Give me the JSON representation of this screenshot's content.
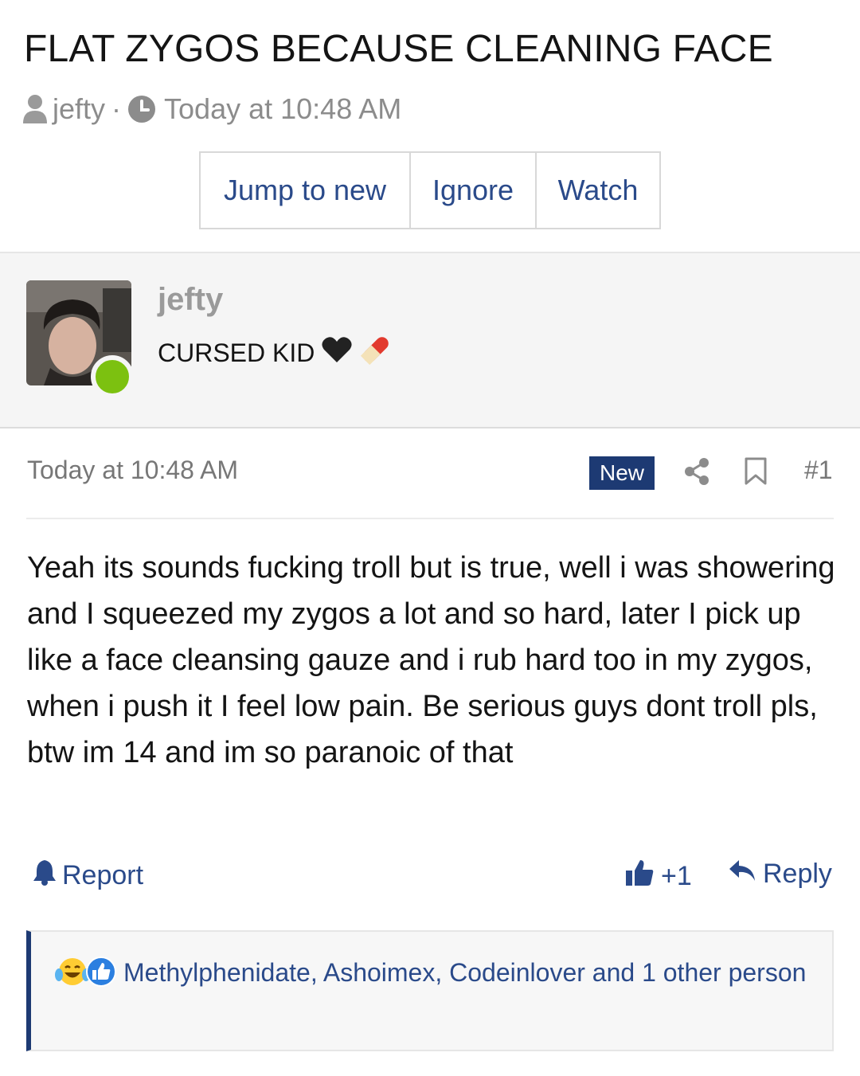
{
  "thread": {
    "title": "FLAT ZYGOS BECAUSE CLEANING FACE",
    "author": "jefty",
    "separator": "·",
    "time": "Today at 10:48 AM"
  },
  "actions": {
    "jump_label": "Jump to new",
    "ignore_label": "Ignore",
    "watch_label": "Watch"
  },
  "user": {
    "name": "jefty",
    "title": "CURSED KID",
    "online": true,
    "title_emojis": [
      "black-heart",
      "pill"
    ]
  },
  "post": {
    "date": "Today at 10:48 AM",
    "badge": "New",
    "number": "#1",
    "body": "Yeah its sounds fucking troll but is true, well i was showering and I squeezed my zygos a lot and so hard, later I pick up like a face cleansing gauze and i rub hard too in my zygos, when i push it I feel low pain. Be serious guys dont troll pls, btw im 14 and im so paranoic of that"
  },
  "footer": {
    "report_label": "Report",
    "like_label": "+1",
    "reply_label": "Reply"
  },
  "reactions": {
    "icons": [
      "laughing-tears-emoji",
      "thumbs-up-reaction"
    ],
    "text": "Methylphenidate, Ashoimex, Codeinlover and 1 other person"
  },
  "colors": {
    "link": "#2a4a8a",
    "badge_bg": "#1d3a73",
    "online": "#7cc110",
    "muted": "#8c8c8c"
  }
}
